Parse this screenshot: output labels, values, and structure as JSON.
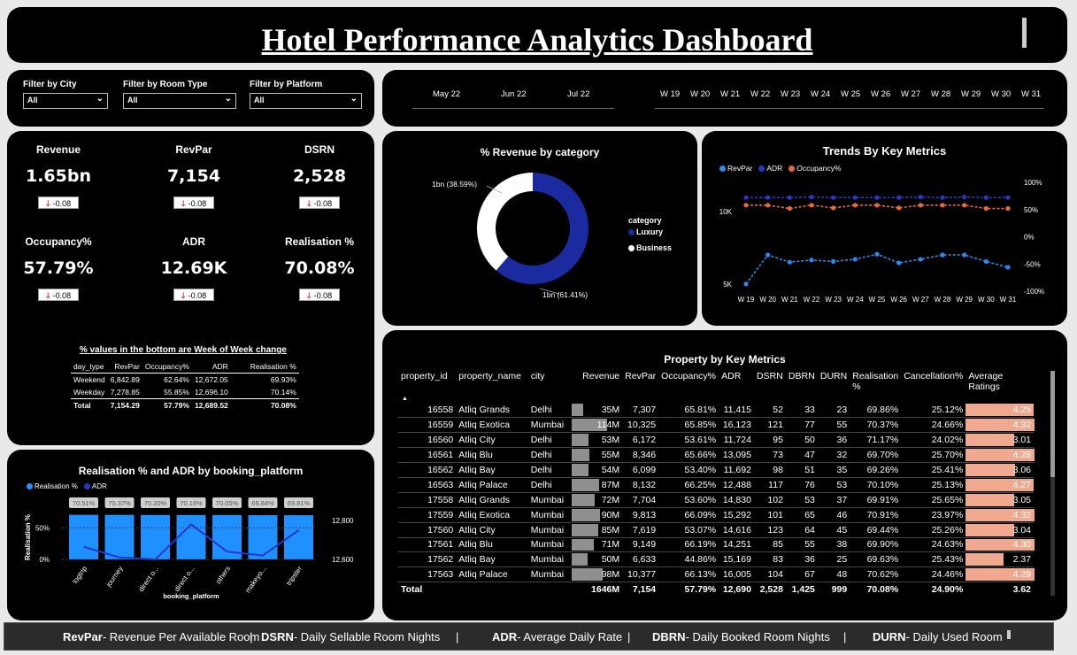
{
  "header": {
    "title": "Hotel Performance Analytics Dashboard"
  },
  "filters": [
    {
      "label": "Filter by City",
      "value": "All"
    },
    {
      "label": "Filter by Room Type",
      "value": "All"
    },
    {
      "label": "Filter by Platform",
      "value": "All"
    }
  ],
  "months": [
    "May 22",
    "Jun 22",
    "Jul 22"
  ],
  "weeks": [
    "W 19",
    "W 20",
    "W 21",
    "W 22",
    "W 23",
    "W 24",
    "W 25",
    "W 26",
    "W 27",
    "W 28",
    "W 29",
    "W 30",
    "W 31"
  ],
  "kpis": [
    {
      "label": "Revenue",
      "value": "1.65bn",
      "change": "-0.08"
    },
    {
      "label": "RevPar",
      "value": "7,154",
      "change": "-0.08"
    },
    {
      "label": "DSRN",
      "value": "2,528",
      "change": "-0.08"
    },
    {
      "label": "Occupancy%",
      "value": "57.79%",
      "change": "-0.08"
    },
    {
      "label": "ADR",
      "value": "12.69K",
      "change": "-0.08"
    },
    {
      "label": "Realisation %",
      "value": "70.08%",
      "change": "-0.08"
    }
  ],
  "day_type_table": {
    "caption": "% values in the bottom are Week of Week change",
    "headers": [
      "day_type",
      "RevPar",
      "Occupancy%",
      "ADR",
      "Realisation %"
    ],
    "rows": [
      [
        "Weekend",
        "6,842.89",
        "62.64%",
        "12,672.05",
        "69.93%"
      ],
      [
        "Weekday",
        "7,278.85",
        "55.85%",
        "12,696.10",
        "70.14%"
      ]
    ],
    "total": [
      "Total",
      "7,154.29",
      "57.79%",
      "12,689.52",
      "70.08%"
    ]
  },
  "platform_chart": {
    "title": "Realisation % and ADR by booking_platform",
    "legend": [
      "Realisation %",
      "ADR"
    ],
    "xlabel": "booking_platform",
    "ylabel": "Realisation %",
    "left_ticks": [
      "50%",
      "0%"
    ],
    "right_ticks": [
      "12,800",
      "12,600"
    ]
  },
  "donut": {
    "title": "% Revenue by category",
    "legend_title": "category",
    "labels": [
      "1bn (38.59%)",
      "1bn (61.41%)"
    ],
    "legend": [
      "Luxury",
      "Business"
    ]
  },
  "trends": {
    "title": "Trends By Key Metrics",
    "legend": [
      "RevPar",
      "ADR",
      "Occupancy%"
    ],
    "left_ticks": [
      "10K",
      "5K"
    ],
    "right_ticks": [
      "100%",
      "50%",
      "0%",
      "-50%",
      "-100%"
    ]
  },
  "property_table": {
    "title": "Property by Key Metrics",
    "headers": [
      "property_id",
      "property_name",
      "city",
      "Revenue",
      "RevPar",
      "Occupancy%",
      "ADR",
      "DSRN",
      "DBRN",
      "DURN",
      "Realisation %",
      "Cancellation%",
      "Average Ratings"
    ],
    "rows": [
      [
        "16558",
        "Atliq Grands",
        "Delhi",
        "35M",
        "7,307",
        "65.81%",
        "11,415",
        "52",
        "33",
        "23",
        "69.86%",
        "25.12%",
        "4.25"
      ],
      [
        "16559",
        "Atliq Exotica",
        "Mumbai",
        "114M",
        "10,325",
        "65.85%",
        "16,123",
        "121",
        "77",
        "55",
        "70.37%",
        "24.66%",
        "4.32"
      ],
      [
        "16560",
        "Atliq City",
        "Delhi",
        "53M",
        "6,172",
        "53.61%",
        "11,724",
        "95",
        "50",
        "36",
        "71.17%",
        "24.02%",
        "3.01"
      ],
      [
        "16561",
        "Atliq Blu",
        "Delhi",
        "55M",
        "8,346",
        "65.66%",
        "13,095",
        "73",
        "47",
        "32",
        "69.70%",
        "25.70%",
        "4.28"
      ],
      [
        "16562",
        "Atliq Bay",
        "Delhi",
        "54M",
        "6,099",
        "53.40%",
        "11,692",
        "98",
        "51",
        "35",
        "69.26%",
        "25.41%",
        "3.06"
      ],
      [
        "16563",
        "Atliq Palace",
        "Delhi",
        "87M",
        "8,132",
        "66.25%",
        "12,488",
        "117",
        "76",
        "53",
        "70.10%",
        "25.13%",
        "4.27"
      ],
      [
        "17558",
        "Atliq Grands",
        "Mumbai",
        "72M",
        "7,704",
        "53.60%",
        "14,830",
        "102",
        "53",
        "37",
        "69.91%",
        "25.65%",
        "3.05"
      ],
      [
        "17559",
        "Atliq Exotica",
        "Mumbai",
        "90M",
        "9,813",
        "66.09%",
        "15,292",
        "101",
        "65",
        "46",
        "70.91%",
        "23.97%",
        "4.32"
      ],
      [
        "17560",
        "Atliq City",
        "Mumbai",
        "85M",
        "7,619",
        "53.07%",
        "14,616",
        "123",
        "64",
        "45",
        "69.44%",
        "25.26%",
        "3.04"
      ],
      [
        "17561",
        "Atliq Blu",
        "Mumbai",
        "71M",
        "9,149",
        "66.19%",
        "14,251",
        "85",
        "55",
        "38",
        "69.90%",
        "24.63%",
        "4.30"
      ],
      [
        "17562",
        "Atliq Bay",
        "Mumbai",
        "50M",
        "6,633",
        "44.86%",
        "15,169",
        "83",
        "36",
        "25",
        "69.63%",
        "25.43%",
        "2.37"
      ],
      [
        "17563",
        "Atliq Palace",
        "Mumbai",
        "98M",
        "10,377",
        "66.13%",
        "16,005",
        "104",
        "67",
        "48",
        "70.62%",
        "24.46%",
        "4.29"
      ]
    ],
    "total": [
      "Total",
      "",
      "",
      "1646M",
      "7,154",
      "57.79%",
      "12,690",
      "2,528",
      "1,425",
      "999",
      "70.08%",
      "24.90%",
      "3.62"
    ]
  },
  "footer": [
    {
      "abbr": "RevPar",
      "desc": "- Revenue Per Available Room"
    },
    {
      "abbr": "DSRN",
      "desc": "- Daily Sellable Room Nights"
    },
    {
      "abbr": "ADR",
      "desc": "- Average Daily Rate"
    },
    {
      "abbr": "DBRN",
      "desc": "- Daily Booked Room Nights"
    },
    {
      "abbr": "DURN",
      "desc": "- Daily Used Room"
    }
  ],
  "colors": {
    "luxury": "#1b2a9e",
    "business": "#ffffff",
    "revpar": "#2a8cf0",
    "adr": "#2a36c9",
    "occupancy": "#e8693a",
    "bars": "#1e90ff",
    "rating": "#f0a98e"
  },
  "chart_data": [
    {
      "type": "pie",
      "title": "% Revenue by category",
      "categories": [
        "Luxury",
        "Business"
      ],
      "values": [
        61.41,
        38.59
      ]
    },
    {
      "type": "line",
      "title": "Trends By Key Metrics",
      "x": [
        "W 19",
        "W 20",
        "W 21",
        "W 22",
        "W 23",
        "W 24",
        "W 25",
        "W 26",
        "W 27",
        "W 28",
        "W 29",
        "W 30",
        "W 31"
      ],
      "series": [
        {
          "name": "RevPar",
          "axis": "left",
          "values": [
            5000,
            7000,
            6500,
            6650,
            6550,
            6700,
            7050,
            6450,
            6700,
            7000,
            7000,
            6550,
            6150
          ]
        },
        {
          "name": "ADR",
          "axis": "right",
          "values": [
            72,
            72,
            72,
            73,
            72,
            72,
            72,
            72,
            73,
            72,
            73,
            72,
            72
          ]
        },
        {
          "name": "Occupancy%",
          "axis": "right",
          "values": [
            58,
            58,
            52,
            58,
            53,
            58,
            58,
            53,
            58,
            58,
            58,
            52,
            52
          ]
        }
      ],
      "ylim": [
        4500,
        12000
      ],
      "y2lim": [
        -100,
        100
      ]
    },
    {
      "type": "bar",
      "title": "Realisation % and ADR by booking_platform",
      "categories": [
        "logtrip",
        "journey",
        "direct o...",
        "direct o...",
        "others",
        "makeyo...",
        "tripster"
      ],
      "series": [
        {
          "name": "Realisation %",
          "values": [
            70.51,
            70.37,
            70.2,
            70.19,
            70.05,
            69.84,
            69.81
          ],
          "labels": [
            "70.51%",
            "70.37%",
            "70.20%",
            "70.19%",
            "70.05%",
            "69.84%",
            "69.81%"
          ]
        },
        {
          "name": "ADR",
          "values": [
            12665,
            12610,
            12600,
            12780,
            12640,
            12620,
            12750
          ]
        }
      ],
      "ylim": [
        0,
        100
      ],
      "y2lim": [
        12600,
        12800
      ]
    }
  ]
}
